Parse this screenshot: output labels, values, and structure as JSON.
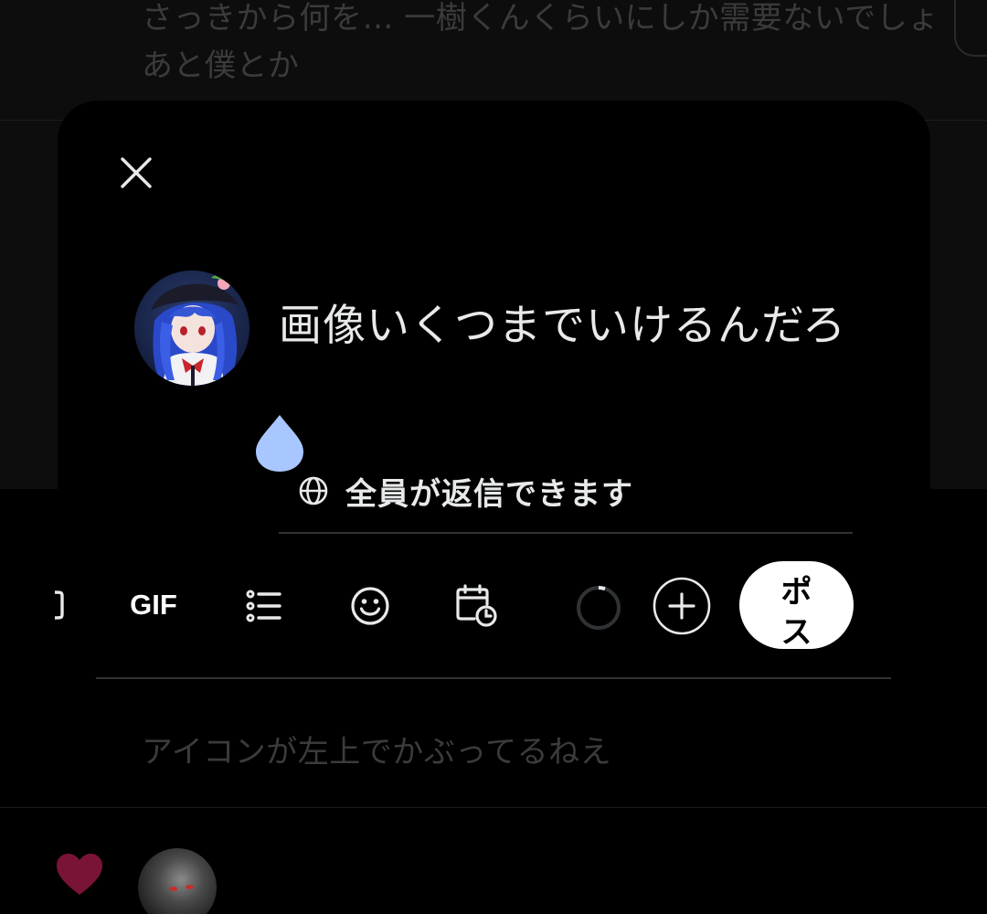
{
  "background": {
    "tweet_top_text": "さっきから何を… 一樹くんくらいにしか需要ないでしょ あと僕とか",
    "tweet_bottom_text": "アイコンが左上でかぶってるねえ",
    "like_color": "#7a1436"
  },
  "compose": {
    "close_icon": "close-icon",
    "draft_text": "画像いくつまでいけるんだろ",
    "reply_setting_label": "全員が返信できます",
    "reply_setting_icon": "globe-icon"
  },
  "toolbar": {
    "gif_label": "GIF",
    "list_icon": "list-icon",
    "emoji_icon": "emoji-icon",
    "schedule_icon": "schedule-icon",
    "progress_icon": "character-progress-ring",
    "add_icon": "plus-icon",
    "post_label": "ポスト",
    "accent_color": "#ffffff"
  }
}
